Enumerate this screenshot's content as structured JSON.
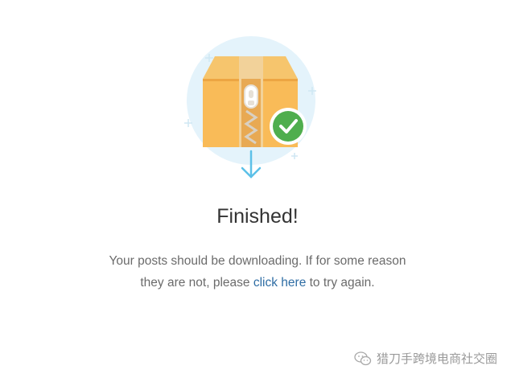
{
  "page": {
    "title": "Finished!",
    "message": {
      "line1": "Your posts should be downloading. If for some reason",
      "line2_prefix": "they are not, please",
      "link_text": "click here",
      "line2_suffix": "to try again."
    }
  },
  "illustration": {
    "icons": [
      "archive-box-icon",
      "zipper-icon",
      "checkmark-icon",
      "download-arrow-icon"
    ]
  },
  "watermark": {
    "text": "猎刀手跨境电商社交圈",
    "icon": "wechat-icon"
  },
  "colors": {
    "circle_bg": "#e4f3fb",
    "box": "#f9bb58",
    "box_dark": "#eda542",
    "check_bg": "#4fae4e",
    "arrow": "#5cc0e8",
    "link": "#2e6da4"
  }
}
